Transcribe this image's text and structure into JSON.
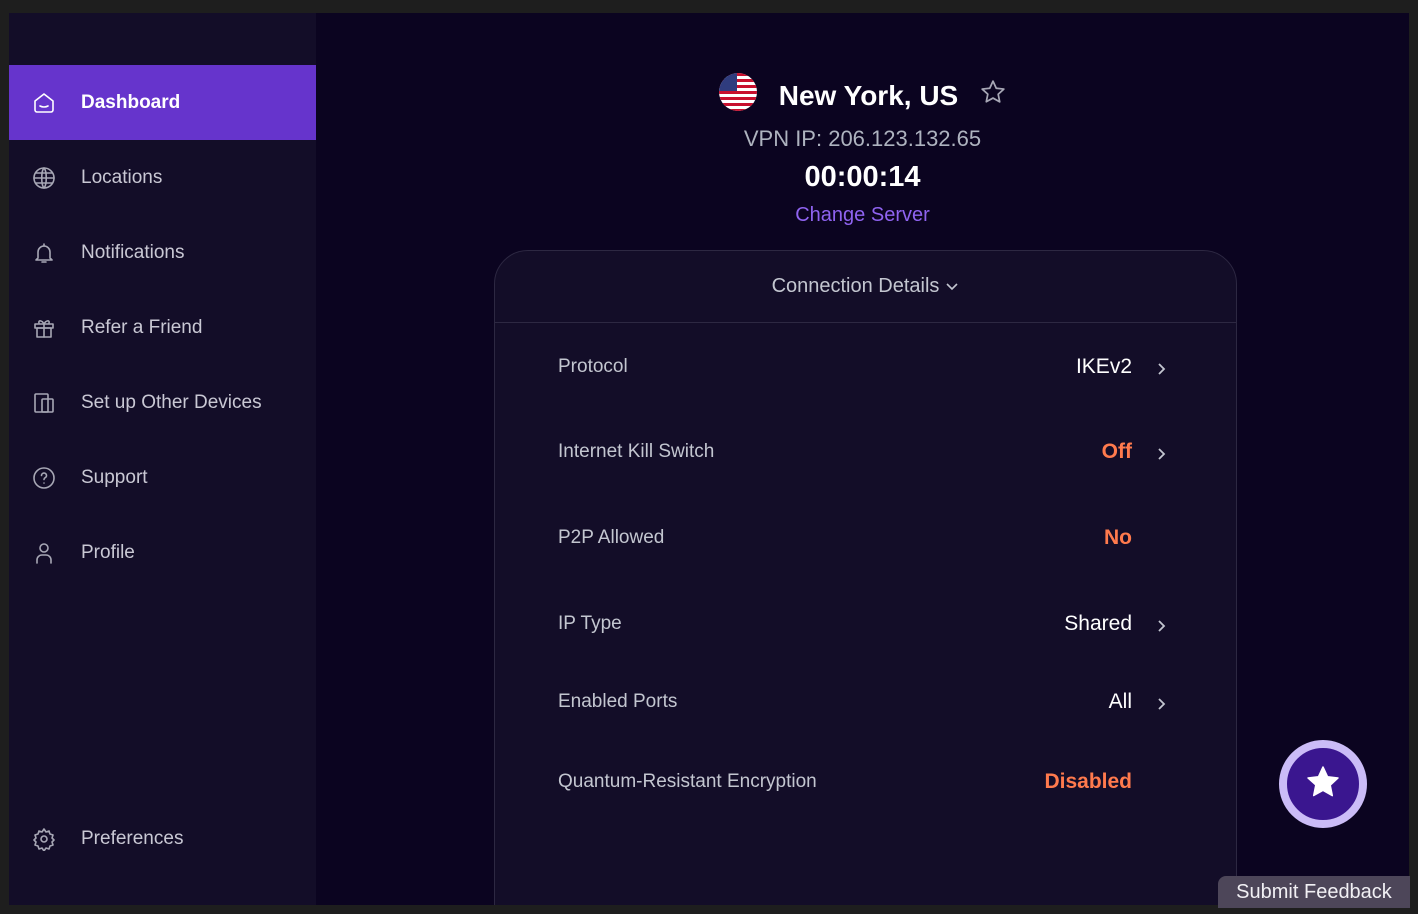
{
  "sidebar": {
    "items": [
      {
        "label": "Dashboard",
        "icon": "home-icon",
        "active": true
      },
      {
        "label": "Locations",
        "icon": "globe-icon"
      },
      {
        "label": "Notifications",
        "icon": "bell-icon"
      },
      {
        "label": "Refer a Friend",
        "icon": "gift-icon"
      },
      {
        "label": "Set up Other Devices",
        "icon": "devices-icon"
      },
      {
        "label": "Support",
        "icon": "help-icon"
      },
      {
        "label": "Profile",
        "icon": "user-icon"
      }
    ],
    "preferences": {
      "label": "Preferences",
      "icon": "gear-icon"
    }
  },
  "header": {
    "location": "New York, US",
    "flag": "us-flag",
    "vpn_ip": "VPN IP: 206.123.132.65",
    "timer": "00:00:14",
    "change_server": "Change Server"
  },
  "details": {
    "title": "Connection Details",
    "rows": [
      {
        "label": "Protocol",
        "value": "IKEv2",
        "chevron": true
      },
      {
        "label": "Internet Kill Switch",
        "value": "Off",
        "warn": true,
        "chevron": true
      },
      {
        "label": "P2P Allowed",
        "value": "No",
        "warn": true,
        "chevron": false
      },
      {
        "label": "IP Type",
        "value": "Shared",
        "chevron": true
      },
      {
        "label": "Enabled Ports",
        "value": "All",
        "chevron": true
      },
      {
        "label": "Quantum-Resistant Encryption",
        "value": "Disabled",
        "warn": true,
        "chevron": false
      }
    ]
  },
  "feedback": {
    "label": "Submit Feedback"
  },
  "colors": {
    "accent": "#6634cc",
    "link": "#8f63f0",
    "warning": "#ff7a4d",
    "sidebar": "#130d28",
    "background": "#0b0420"
  }
}
